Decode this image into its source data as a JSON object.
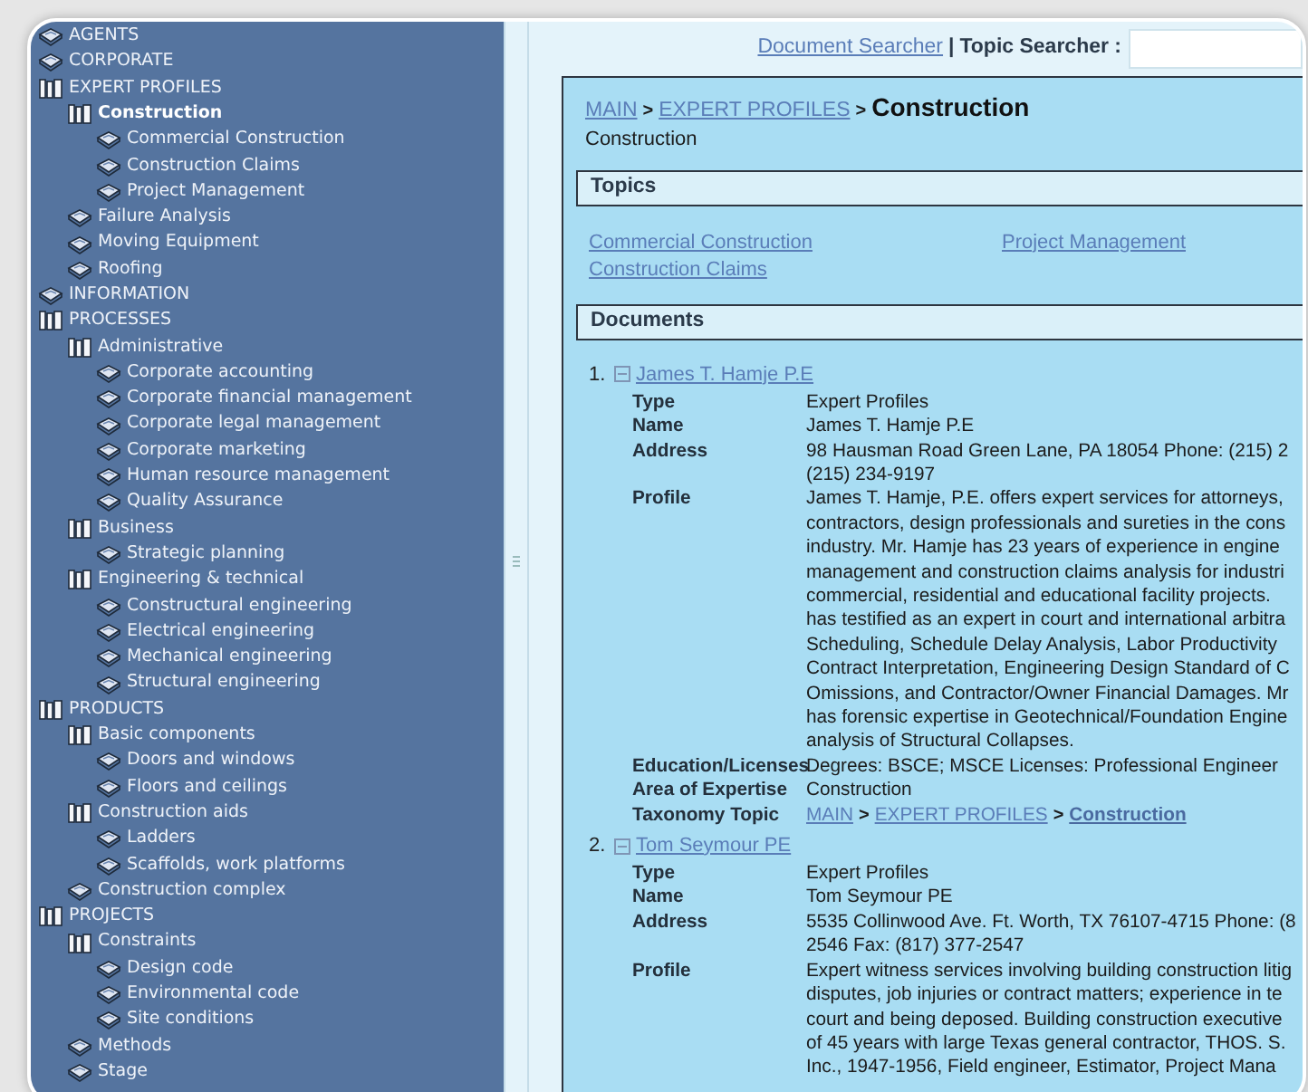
{
  "sidebar": {
    "items": [
      {
        "label": "AGENTS",
        "expanded": false,
        "selected": false
      },
      {
        "label": "CORPORATE",
        "expanded": false,
        "selected": false
      },
      {
        "label": "EXPERT PROFILES",
        "expanded": true,
        "selected": false,
        "children": [
          {
            "label": "Construction",
            "expanded": true,
            "selected": true,
            "children": [
              {
                "label": "Commercial Construction",
                "expanded": false,
                "selected": false
              },
              {
                "label": "Construction Claims",
                "expanded": false,
                "selected": false
              },
              {
                "label": "Project Management",
                "expanded": false,
                "selected": false
              }
            ]
          },
          {
            "label": "Failure Analysis",
            "expanded": false,
            "selected": false
          },
          {
            "label": "Moving Equipment",
            "expanded": false,
            "selected": false
          },
          {
            "label": "Roofing",
            "expanded": false,
            "selected": false
          }
        ]
      },
      {
        "label": "INFORMATION",
        "expanded": false,
        "selected": false
      },
      {
        "label": "PROCESSES",
        "expanded": true,
        "selected": false,
        "children": [
          {
            "label": "Administrative",
            "expanded": true,
            "selected": false,
            "children": [
              {
                "label": "Corporate accounting",
                "expanded": false,
                "selected": false
              },
              {
                "label": "Corporate financial management",
                "expanded": false,
                "selected": false
              },
              {
                "label": "Corporate legal management",
                "expanded": false,
                "selected": false
              },
              {
                "label": "Corporate marketing",
                "expanded": false,
                "selected": false
              },
              {
                "label": "Human resource management",
                "expanded": false,
                "selected": false
              },
              {
                "label": "Quality Assurance",
                "expanded": false,
                "selected": false
              }
            ]
          },
          {
            "label": "Business",
            "expanded": true,
            "selected": false,
            "children": [
              {
                "label": "Strategic planning",
                "expanded": false,
                "selected": false
              }
            ]
          },
          {
            "label": "Engineering & technical",
            "expanded": true,
            "selected": false,
            "children": [
              {
                "label": "Constructural engineering",
                "expanded": false,
                "selected": false
              },
              {
                "label": "Electrical engineering",
                "expanded": false,
                "selected": false
              },
              {
                "label": "Mechanical engineering",
                "expanded": false,
                "selected": false
              },
              {
                "label": "Structural engineering",
                "expanded": false,
                "selected": false
              }
            ]
          }
        ]
      },
      {
        "label": "PRODUCTS",
        "expanded": true,
        "selected": false,
        "children": [
          {
            "label": "Basic components",
            "expanded": true,
            "selected": false,
            "children": [
              {
                "label": "Doors and windows",
                "expanded": false,
                "selected": false
              },
              {
                "label": "Floors and ceilings",
                "expanded": false,
                "selected": false
              }
            ]
          },
          {
            "label": "Construction aids",
            "expanded": true,
            "selected": false,
            "children": [
              {
                "label": "Ladders",
                "expanded": false,
                "selected": false
              },
              {
                "label": "Scaffolds, work platforms",
                "expanded": false,
                "selected": false
              }
            ]
          },
          {
            "label": "Construction complex",
            "expanded": false,
            "selected": false
          }
        ]
      },
      {
        "label": "PROJECTS",
        "expanded": true,
        "selected": false,
        "children": [
          {
            "label": "Constraints",
            "expanded": true,
            "selected": false,
            "children": [
              {
                "label": "Design code",
                "expanded": false,
                "selected": false
              },
              {
                "label": "Environmental code",
                "expanded": false,
                "selected": false
              },
              {
                "label": "Site conditions",
                "expanded": false,
                "selected": false
              }
            ]
          },
          {
            "label": "Methods",
            "expanded": false,
            "selected": false
          },
          {
            "label": "Stage",
            "expanded": false,
            "selected": false
          }
        ]
      }
    ]
  },
  "toolbar": {
    "document_searcher": "Document Searcher",
    "separator": "|",
    "topic_searcher_label": "Topic Searcher :"
  },
  "breadcrumb": [
    {
      "kind": "link",
      "text": "MAIN"
    },
    {
      "kind": "separator",
      "text": ">"
    },
    {
      "kind": "link",
      "text": "EXPERT PROFILES"
    },
    {
      "kind": "separator",
      "text": ">"
    },
    {
      "kind": "current",
      "text": "Construction"
    }
  ],
  "page_subtitle": "Construction",
  "topics": {
    "heading": "Topics",
    "links": [
      "Commercial Construction",
      "Project Management",
      "Construction Claims"
    ]
  },
  "documents": {
    "heading": "Documents",
    "items": [
      {
        "number": "1.",
        "expanded": true,
        "title": "James T. Hamje P.E",
        "fields": [
          {
            "kind": "text",
            "label": "Type",
            "lines": [
              "Expert Profiles"
            ]
          },
          {
            "kind": "text",
            "label": "Name",
            "lines": [
              "James T. Hamje P.E"
            ]
          },
          {
            "kind": "text",
            "label": "Address",
            "lines": [
              "98 Hausman Road Green Lane, PA 18054 Phone: (215) 2",
              "(215) 234-9197"
            ]
          },
          {
            "kind": "text",
            "label": "Profile",
            "lines": [
              "James T. Hamje, P.E. offers expert services for attorneys,",
              "contractors, design professionals and sureties in the cons",
              "industry. Mr. Hamje has 23 years of experience in engine",
              "management and construction claims analysis for industri",
              "commercial, residential and educational facility projects.",
              "has testified as an expert in court and international arbitra",
              "Scheduling, Schedule Delay Analysis, Labor Productivity",
              "Contract Interpretation, Engineering Design Standard of C",
              "Omissions, and Contractor/Owner Financial Damages. Mr",
              "has forensic expertise in Geotechnical/Foundation Engine",
              "analysis of Structural Collapses."
            ]
          },
          {
            "kind": "text",
            "label": "Education/Licenses",
            "lines": [
              "Degrees: BSCE; MSCE Licenses: Professional Engineer"
            ]
          },
          {
            "kind": "text",
            "label": "Area of Expertise",
            "lines": [
              "Construction"
            ]
          },
          {
            "kind": "breadcrumb",
            "label": "Taxonomy Topic",
            "parts": [
              {
                "kind": "link",
                "text": "MAIN"
              },
              {
                "kind": "separator",
                "text": ">"
              },
              {
                "kind": "link",
                "text": "EXPERT PROFILES"
              },
              {
                "kind": "separator",
                "text": ">"
              },
              {
                "kind": "current",
                "text": "Construction"
              }
            ]
          }
        ]
      },
      {
        "number": "2.",
        "expanded": true,
        "title": "Tom Seymour PE",
        "fields": [
          {
            "kind": "text",
            "label": "Type",
            "lines": [
              "Expert Profiles"
            ]
          },
          {
            "kind": "text",
            "label": "Name",
            "lines": [
              "Tom Seymour PE"
            ]
          },
          {
            "kind": "text",
            "label": "Address",
            "lines": [
              "5535 Collinwood Ave. Ft. Worth, TX 76107-4715 Phone: (8",
              "2546 Fax: (817) 377-2547"
            ]
          },
          {
            "kind": "text",
            "label": "Profile",
            "lines": [
              "Expert witness services involving building construction litig",
              "disputes, job injuries or contract matters; experience in te",
              "court and being deposed. Building construction executive",
              "of 45 years with large Texas general contractor, THOS. S.",
              "Inc., 1947-1956, Field engineer, Estimator, Project Mana"
            ]
          }
        ]
      }
    ]
  }
}
